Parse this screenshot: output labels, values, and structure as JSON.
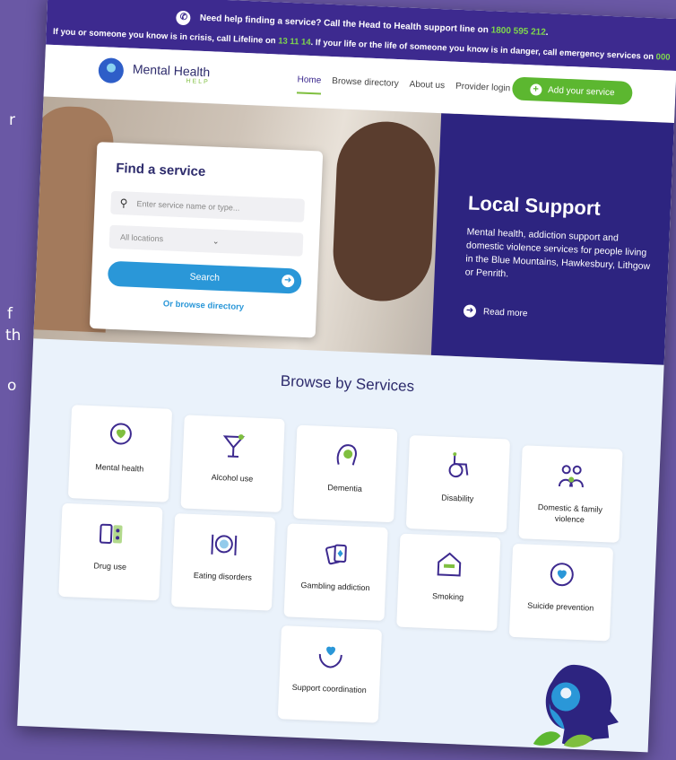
{
  "side_fragments": [
    "r",
    "f",
    "th",
    "o"
  ],
  "topbar": {
    "line1": "Need help finding a service? Call the Head to Health support line on ",
    "line1_phone": "1800 595 212",
    "line2a": "If you or someone you know is in crisis, call Lifeline on ",
    "line2_phone": "13 11 14",
    "line2b": ". If your life or the life of someone you know is in danger, call emergency services on ",
    "line2_emergency": "000"
  },
  "logo": {
    "name": "Mental Health",
    "sub": "HELP"
  },
  "nav": {
    "items": [
      "Home",
      "Browse directory",
      "About us",
      "Provider login"
    ],
    "add_button": "Add your service"
  },
  "find": {
    "title": "Find a service",
    "search_placeholder": "Enter service name or type...",
    "location_value": "All locations",
    "search_button": "Search",
    "browse_link": "Or browse directory"
  },
  "local": {
    "title": "Local Support",
    "body": "Mental health, addiction support and domestic violence services for people living in the Blue Mountains, Hawkesbury, Lithgow or Penrith.",
    "read_more": "Read more"
  },
  "browse": {
    "title": "Browse by Services",
    "tiles": [
      {
        "label": "Mental health",
        "icon": "brain-heart-icon"
      },
      {
        "label": "Alcohol use",
        "icon": "cocktail-glass-icon"
      },
      {
        "label": "Dementia",
        "icon": "head-swirl-icon"
      },
      {
        "label": "Disability",
        "icon": "wheelchair-icon"
      },
      {
        "label": "Domestic & family violence",
        "icon": "family-icon"
      },
      {
        "label": "Drug use",
        "icon": "pills-icon"
      },
      {
        "label": "Eating disorders",
        "icon": "plate-cutlery-icon"
      },
      {
        "label": "Gambling addiction",
        "icon": "playing-cards-icon"
      },
      {
        "label": "Smoking",
        "icon": "no-smoking-icon"
      },
      {
        "label": "Suicide prevention",
        "icon": "heart-circle-icon"
      },
      {
        "label": "Support coordination",
        "icon": "hands-heart-icon"
      }
    ]
  },
  "colors": {
    "brand_purple": "#2d2480",
    "accent_green": "#5cb730",
    "button_blue": "#2a97d8"
  }
}
